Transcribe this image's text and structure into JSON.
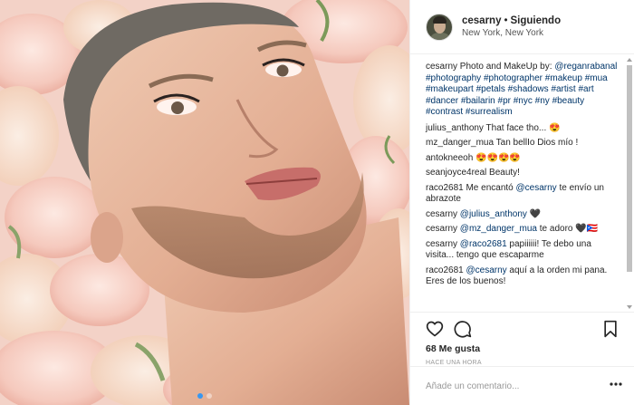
{
  "post": {
    "carousel_count": 2,
    "carousel_active": 1
  },
  "header": {
    "username": "cesarny",
    "separator": "•",
    "follow_status": "Siguiendo",
    "location": "New York, New York"
  },
  "caption": {
    "username": "cesarny",
    "text_parts": [
      {
        "text": " Photo and MakeUp by: ",
        "tag": false
      },
      {
        "text": "@reganrabanal",
        "tag": true
      },
      {
        "text": " ",
        "tag": false
      },
      {
        "text": "#photography",
        "tag": true
      },
      {
        "text": " ",
        "tag": false
      },
      {
        "text": "#photographer",
        "tag": true
      },
      {
        "text": " ",
        "tag": false
      },
      {
        "text": "#makeup",
        "tag": true
      },
      {
        "text": " ",
        "tag": false
      },
      {
        "text": "#mua",
        "tag": true
      },
      {
        "text": " ",
        "tag": false
      },
      {
        "text": "#makeupart",
        "tag": true
      },
      {
        "text": " ",
        "tag": false
      },
      {
        "text": "#petals",
        "tag": true
      },
      {
        "text": " ",
        "tag": false
      },
      {
        "text": "#shadows",
        "tag": true
      },
      {
        "text": " ",
        "tag": false
      },
      {
        "text": "#artist",
        "tag": true
      },
      {
        "text": " ",
        "tag": false
      },
      {
        "text": "#art",
        "tag": true
      },
      {
        "text": " ",
        "tag": false
      },
      {
        "text": "#dancer",
        "tag": true
      },
      {
        "text": " ",
        "tag": false
      },
      {
        "text": "#bailarin",
        "tag": true
      },
      {
        "text": " ",
        "tag": false
      },
      {
        "text": "#pr",
        "tag": true
      },
      {
        "text": " ",
        "tag": false
      },
      {
        "text": "#nyc",
        "tag": true
      },
      {
        "text": " ",
        "tag": false
      },
      {
        "text": "#ny",
        "tag": true
      },
      {
        "text": " ",
        "tag": false
      },
      {
        "text": "#beauty",
        "tag": true
      },
      {
        "text": " ",
        "tag": false
      },
      {
        "text": "#contrast",
        "tag": true
      },
      {
        "text": " ",
        "tag": false
      },
      {
        "text": "#surrealism",
        "tag": true
      }
    ]
  },
  "comments": [
    {
      "user": "julius_anthony",
      "parts": [
        {
          "text": " That face tho... 😍",
          "tag": false
        }
      ]
    },
    {
      "user": "mz_danger_mua",
      "parts": [
        {
          "text": " Tan bellIo Dios mío !",
          "tag": false
        }
      ]
    },
    {
      "user": "antokneeoh",
      "parts": [
        {
          "text": " 😍😍😍😍",
          "tag": false
        }
      ]
    },
    {
      "user": "seanjoyce4real",
      "parts": [
        {
          "text": " Beauty!",
          "tag": false
        }
      ]
    },
    {
      "user": "raco2681",
      "parts": [
        {
          "text": " Me encantó ",
          "tag": false
        },
        {
          "text": "@cesarny",
          "tag": true
        },
        {
          "text": " te envío un abrazote",
          "tag": false
        }
      ]
    },
    {
      "user": "cesarny",
      "parts": [
        {
          "text": " ",
          "tag": false
        },
        {
          "text": "@julius_anthony",
          "tag": true
        },
        {
          "text": " 🖤",
          "tag": false
        }
      ]
    },
    {
      "user": "cesarny",
      "parts": [
        {
          "text": " ",
          "tag": false
        },
        {
          "text": "@mz_danger_mua",
          "tag": true
        },
        {
          "text": " te adoro 🖤🇵🇷",
          "tag": false
        }
      ]
    },
    {
      "user": "cesarny",
      "parts": [
        {
          "text": " ",
          "tag": false
        },
        {
          "text": "@raco2681",
          "tag": true
        },
        {
          "text": " papiiiiii! Te debo una visita... tengo que escaparme",
          "tag": false
        }
      ]
    },
    {
      "user": "raco2681",
      "parts": [
        {
          "text": " ",
          "tag": false
        },
        {
          "text": "@cesarny",
          "tag": true
        },
        {
          "text": " aquí a la orden mi pana. Eres de los buenos!",
          "tag": false
        }
      ]
    }
  ],
  "actions": {
    "like_icon": "heart-outline-icon",
    "comment_icon": "speech-bubble-icon",
    "save_icon": "bookmark-icon",
    "likes_text": "68 Me gusta",
    "time_text": "HACE UNA HORA"
  },
  "add_comment": {
    "placeholder": "Añade un comentario..."
  },
  "colors": {
    "tag": "#003569",
    "carousel_active": "#3897f0",
    "divider": "#efefef"
  }
}
